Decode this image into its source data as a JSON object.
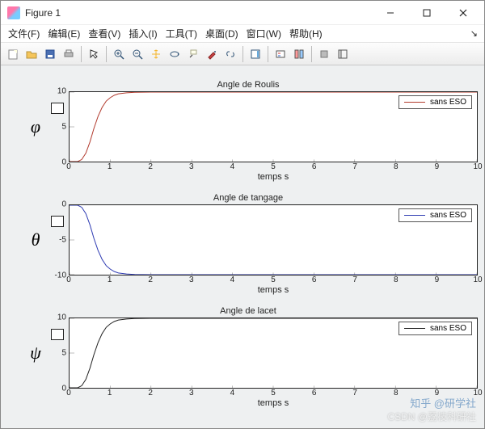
{
  "window": {
    "title": "Figure 1"
  },
  "menus": {
    "file": "文件(F)",
    "edit": "编辑(E)",
    "view": "查看(V)",
    "insert": "插入(I)",
    "tools": "工具(T)",
    "desktop": "桌面(D)",
    "window": "窗口(W)",
    "help": "帮助(H)"
  },
  "chart_data": [
    {
      "type": "line",
      "title": "Angle de Roulis",
      "xlabel": "temps s",
      "ylabel": "φ",
      "xlim": [
        0,
        10
      ],
      "ylim": [
        0,
        10
      ],
      "xticks": [
        0,
        1,
        2,
        3,
        4,
        5,
        6,
        7,
        8,
        9,
        10
      ],
      "yticks": [
        0,
        5,
        10
      ],
      "series": [
        {
          "name": "sans ESO",
          "color": "#b23b2e",
          "x": [
            0,
            0.2,
            0.3,
            0.4,
            0.5,
            0.6,
            0.7,
            0.8,
            0.9,
            1.0,
            1.1,
            1.2,
            1.4,
            1.6,
            2.0,
            3,
            10
          ],
          "y": [
            0,
            0,
            0.3,
            1.2,
            2.8,
            4.8,
            6.5,
            7.8,
            8.7,
            9.2,
            9.55,
            9.75,
            9.9,
            9.97,
            10,
            10,
            10
          ]
        }
      ]
    },
    {
      "type": "line",
      "title": "Angle de tangage",
      "xlabel": "temps s",
      "ylabel": "θ",
      "xlim": [
        0,
        10
      ],
      "ylim": [
        -10,
        0
      ],
      "xticks": [
        0,
        1,
        2,
        3,
        4,
        5,
        6,
        7,
        8,
        9,
        10
      ],
      "yticks": [
        -10,
        -5,
        0
      ],
      "series": [
        {
          "name": "sans ESO",
          "color": "#2e3bb2",
          "x": [
            0,
            0.2,
            0.3,
            0.4,
            0.5,
            0.6,
            0.7,
            0.8,
            0.9,
            1.0,
            1.1,
            1.2,
            1.4,
            1.6,
            2.0,
            3,
            10
          ],
          "y": [
            0,
            0,
            -0.3,
            -1.2,
            -2.8,
            -4.8,
            -6.5,
            -7.8,
            -8.7,
            -9.2,
            -9.55,
            -9.75,
            -9.9,
            -9.97,
            -10,
            -10,
            -10
          ]
        }
      ]
    },
    {
      "type": "line",
      "title": "Angle de lacet",
      "xlabel": "temps s",
      "ylabel": "ψ",
      "xlim": [
        0,
        10
      ],
      "ylim": [
        0,
        10
      ],
      "xticks": [
        0,
        1,
        2,
        3,
        4,
        5,
        6,
        7,
        8,
        9,
        10
      ],
      "yticks": [
        0,
        5,
        10
      ],
      "series": [
        {
          "name": "sans ESO",
          "color": "#222222",
          "x": [
            0,
            0.2,
            0.3,
            0.4,
            0.5,
            0.6,
            0.7,
            0.8,
            0.9,
            1.0,
            1.1,
            1.2,
            1.4,
            1.6,
            2.0,
            3,
            10
          ],
          "y": [
            0,
            0,
            0.3,
            1.2,
            2.8,
            4.8,
            6.5,
            7.8,
            8.7,
            9.2,
            9.55,
            9.75,
            9.9,
            9.97,
            10,
            10,
            10
          ]
        }
      ]
    }
  ],
  "watermarks": {
    "w1": "知乎 @研学社",
    "w2": "CSDN @荔枝科研社"
  }
}
